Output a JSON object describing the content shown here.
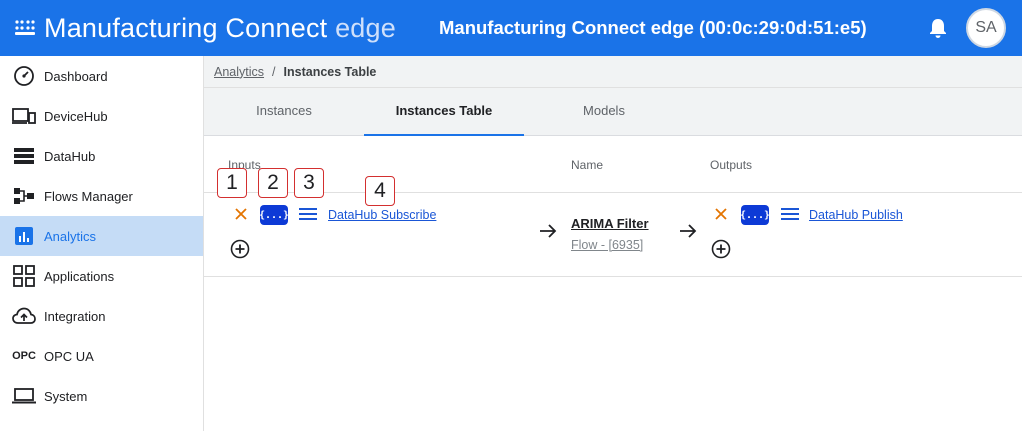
{
  "header": {
    "brand_main": "Manufacturing Connect",
    "brand_suffix": "edge",
    "device_title": "Manufacturing Connect edge (00:0c:29:0d:51:e5)",
    "avatar_initials": "SA"
  },
  "sidebar": {
    "items": [
      {
        "label": "Dashboard",
        "icon": "dashboard-gauge-icon"
      },
      {
        "label": "DeviceHub",
        "icon": "devices-icon"
      },
      {
        "label": "DataHub",
        "icon": "storage-icon"
      },
      {
        "label": "Flows Manager",
        "icon": "flows-icon"
      },
      {
        "label": "Analytics",
        "icon": "analytics-icon",
        "active": true
      },
      {
        "label": "Applications",
        "icon": "apps-grid-icon"
      },
      {
        "label": "Integration",
        "icon": "cloud-upload-icon"
      },
      {
        "label": "OPC UA",
        "icon": "opc-text-icon",
        "icon_text": "OPC"
      },
      {
        "label": "System",
        "icon": "laptop-icon"
      }
    ]
  },
  "breadcrumb": {
    "parent": "Analytics",
    "separator": "/",
    "current": "Instances Table"
  },
  "tabs": [
    {
      "label": "Instances"
    },
    {
      "label": "Instances Table",
      "active": true
    },
    {
      "label": "Models"
    }
  ],
  "table": {
    "headers": {
      "inputs": "Inputs",
      "name": "Name",
      "outputs": "Outputs"
    },
    "row": {
      "input_link": "DataHub Subscribe",
      "name": "ARIMA Filter",
      "flow_id": "Flow - [6935]",
      "output_link": "DataHub Publish",
      "json_badge": "{...}"
    }
  },
  "callouts": [
    "1",
    "2",
    "3",
    "4"
  ],
  "colors": {
    "primary": "#1a73e8",
    "remove": "#e37400",
    "json_badge": "#0d3ad6",
    "callout_border": "#d32f2f",
    "active_nav": "#c5dcf6"
  }
}
